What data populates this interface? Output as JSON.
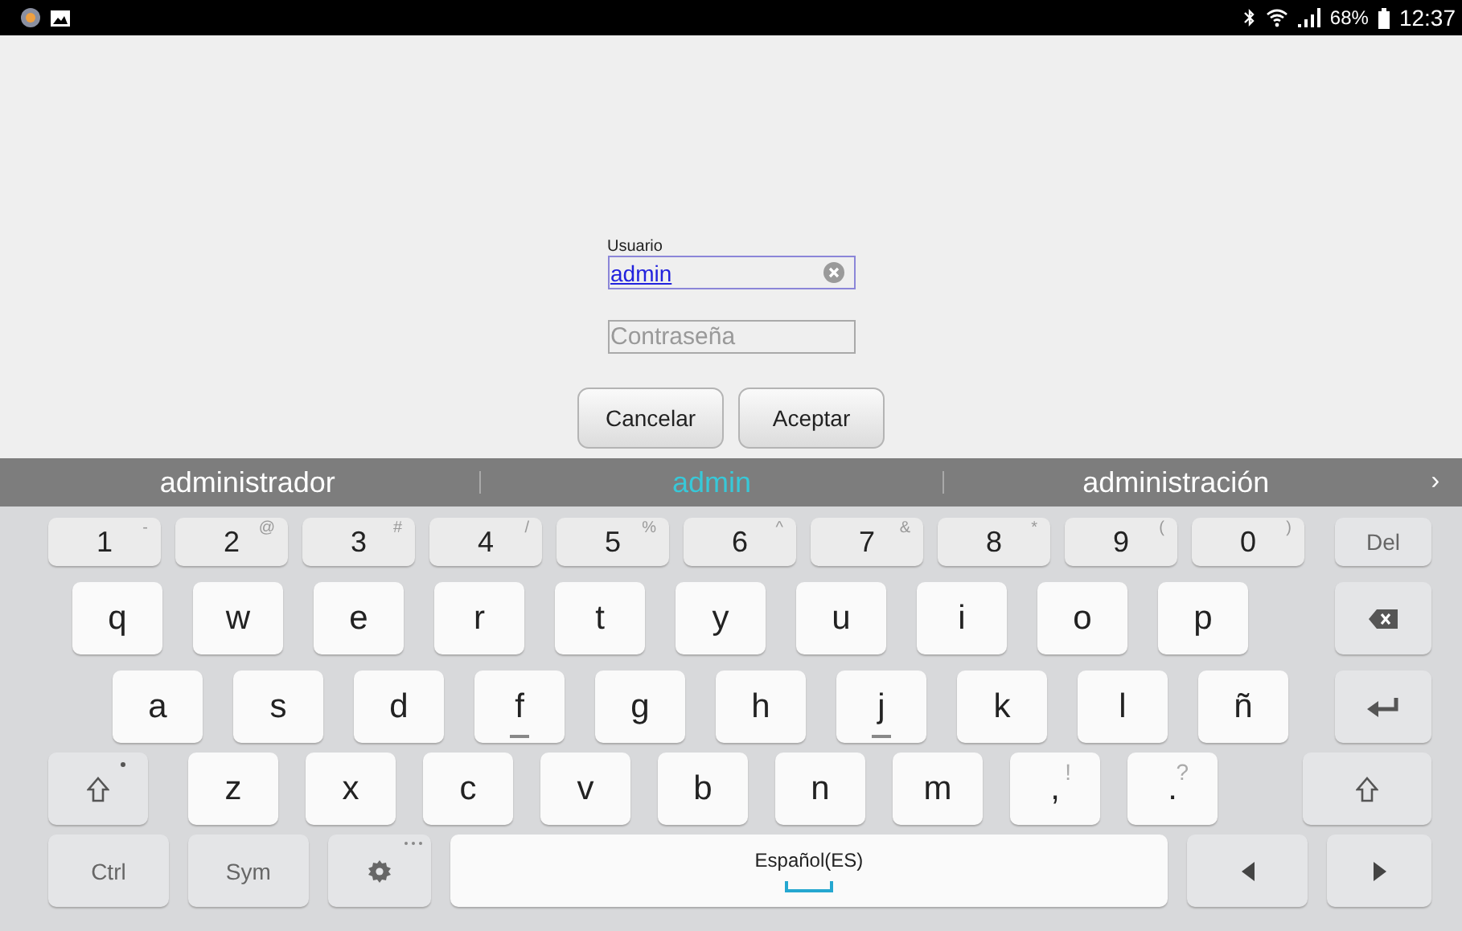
{
  "status_bar": {
    "battery": "68%",
    "time": "12:37"
  },
  "login": {
    "username": {
      "label": "Usuario",
      "value": "admin"
    },
    "password": {
      "placeholder": "Contraseña"
    },
    "buttons": [
      "Cancelar",
      "Aceptar"
    ]
  },
  "suggestions": {
    "items": [
      {
        "text": "administrador",
        "selected": false
      },
      {
        "text": "admin",
        "selected": true
      },
      {
        "text": "administración",
        "selected": false
      }
    ],
    "more": "›"
  },
  "keyboard": {
    "rows": [
      [
        {
          "label": "1",
          "hint": "-",
          "kind": "num"
        },
        {
          "label": "2",
          "hint": "@",
          "kind": "num"
        },
        {
          "label": "3",
          "hint": "#",
          "kind": "num"
        },
        {
          "label": "4",
          "hint": "/",
          "kind": "num"
        },
        {
          "label": "5",
          "hint": "%",
          "kind": "num"
        },
        {
          "label": "6",
          "hint": "^",
          "kind": "num"
        },
        {
          "label": "7",
          "hint": "&",
          "kind": "num"
        },
        {
          "label": "8",
          "hint": "*",
          "kind": "num"
        },
        {
          "label": "9",
          "hint": "(",
          "kind": "num"
        },
        {
          "label": "0",
          "hint": ")",
          "kind": "num"
        },
        {
          "label": "Del",
          "kind": "del"
        }
      ],
      [
        {
          "label": "q",
          "kind": "char"
        },
        {
          "label": "w",
          "kind": "char"
        },
        {
          "label": "e",
          "kind": "char"
        },
        {
          "label": "r",
          "kind": "char"
        },
        {
          "label": "t",
          "kind": "char"
        },
        {
          "label": "y",
          "kind": "char"
        },
        {
          "label": "u",
          "kind": "char"
        },
        {
          "label": "i",
          "kind": "char"
        },
        {
          "label": "o",
          "kind": "char"
        },
        {
          "label": "p",
          "kind": "char"
        },
        {
          "kind": "backspace"
        }
      ],
      [
        {
          "label": "a",
          "kind": "char"
        },
        {
          "label": "s",
          "kind": "char"
        },
        {
          "label": "d",
          "kind": "char"
        },
        {
          "label": "f",
          "kind": "char",
          "bump": true
        },
        {
          "label": "g",
          "kind": "char"
        },
        {
          "label": "h",
          "kind": "char"
        },
        {
          "label": "j",
          "kind": "char",
          "bump": true
        },
        {
          "label": "k",
          "kind": "char"
        },
        {
          "label": "l",
          "kind": "char"
        },
        {
          "label": "ñ",
          "kind": "char"
        },
        {
          "kind": "enter"
        }
      ],
      [
        {
          "kind": "shift",
          "dot": true
        },
        {
          "label": "z",
          "kind": "char"
        },
        {
          "label": "x",
          "kind": "char"
        },
        {
          "label": "c",
          "kind": "char"
        },
        {
          "label": "v",
          "kind": "char"
        },
        {
          "label": "b",
          "kind": "char"
        },
        {
          "label": "n",
          "kind": "char"
        },
        {
          "label": "m",
          "kind": "char"
        },
        {
          "label": ",",
          "hint": "!",
          "kind": "char"
        },
        {
          "label": ".",
          "hint": "?",
          "kind": "char"
        },
        {
          "kind": "shift",
          "dot": false
        }
      ],
      [
        {
          "label": "Ctrl",
          "kind": "fn"
        },
        {
          "label": "Sym",
          "kind": "fn"
        },
        {
          "kind": "settings"
        },
        {
          "label": "Español(ES)",
          "kind": "space"
        },
        {
          "kind": "left"
        },
        {
          "kind": "right"
        }
      ]
    ]
  }
}
